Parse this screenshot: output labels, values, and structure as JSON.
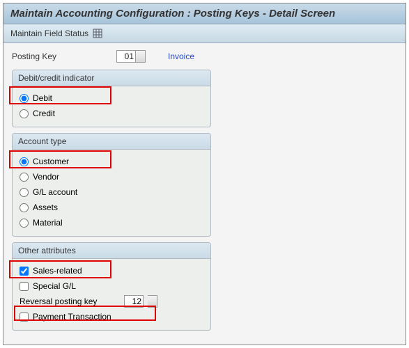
{
  "title": "Maintain Accounting Configuration : Posting Keys - Detail Screen",
  "toolbar": {
    "maintain_field_status": "Maintain Field Status"
  },
  "posting_key": {
    "label": "Posting Key",
    "value": "01",
    "description": "Invoice"
  },
  "group_debit_credit": {
    "title": "Debit/credit indicator",
    "options": [
      {
        "label": "Debit",
        "selected": true
      },
      {
        "label": "Credit",
        "selected": false
      }
    ]
  },
  "group_account_type": {
    "title": "Account type",
    "options": [
      {
        "label": "Customer",
        "selected": true
      },
      {
        "label": "Vendor",
        "selected": false
      },
      {
        "label": "G/L account",
        "selected": false
      },
      {
        "label": "Assets",
        "selected": false
      },
      {
        "label": "Material",
        "selected": false
      }
    ]
  },
  "group_other": {
    "title": "Other attributes",
    "sales_related": {
      "label": "Sales-related",
      "checked": true
    },
    "special_gl": {
      "label": "Special G/L",
      "checked": false
    },
    "reversal": {
      "label": "Reversal posting key",
      "value": "12"
    },
    "payment_tx": {
      "label": "Payment Transaction",
      "checked": false
    }
  }
}
